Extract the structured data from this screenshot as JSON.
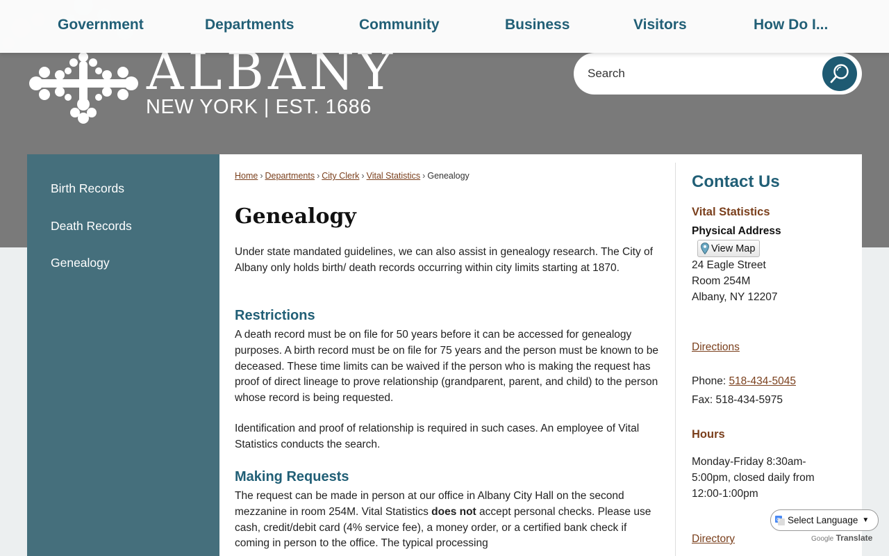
{
  "nav": {
    "items": [
      "Government",
      "Departments",
      "Community",
      "Business",
      "Visitors",
      "How Do I..."
    ]
  },
  "logo": {
    "wordmark": "ALBANY",
    "tagline": "NEW YORK | EST. 1686"
  },
  "search": {
    "placeholder": "Search"
  },
  "sidebar": {
    "items": [
      "Birth Records",
      "Death Records",
      "Genealogy"
    ]
  },
  "breadcrumb": {
    "links": [
      "Home",
      "Departments",
      "City Clerk",
      "Vital Statistics"
    ],
    "current": "Genealogy"
  },
  "main": {
    "title": "Genealogy",
    "intro": "Under state mandated guidelines, we can also assist in genealogy research. The City of Albany only holds birth/ death records occurring within city limits starting at 1870.",
    "restrictions_heading": "Restrictions",
    "restrictions_p1": "A death record must be on file for 50 years before it can be accessed for genealogy purposes. A birth record must be on file for 75 years and the person must be known to be deceased. These time limits can be waived if the person who is making the request has proof of direct lineage to prove relationship (grandparent, parent, and child) to the person whose record is being requested.",
    "restrictions_p2": "Identification and proof of relationship is required in such cases. An employee of Vital Statistics conducts the search.",
    "requests_heading": "Making Requests",
    "requests_p1_a": "The request can be made in person at our office in Albany City Hall on the second mezzanine in room 254M. Vital Statistics ",
    "requests_p1_bold": "does not",
    "requests_p1_b": " accept personal checks. Please use cash, credit/debit card (4% service fee), a money order, or a certified bank check if coming in person to the office.  The typical processing"
  },
  "contact": {
    "heading": "Contact Us",
    "dept": "Vital Statistics",
    "address_label": "Physical Address",
    "view_map": "View Map",
    "address_lines": [
      "24 Eagle Street",
      "Room 254M",
      "Albany, NY 12207"
    ],
    "directions": "Directions",
    "phone_label": "Phone: ",
    "phone": "518-434-5045",
    "fax": "Fax: 518-434-5975",
    "hours_heading": "Hours",
    "hours": "Monday-Friday 8:30am-5:00pm, closed daily from 12:00-1:00pm",
    "directory": "Directory"
  },
  "translate": {
    "label": "Select Language",
    "powered_google": "Google",
    "powered_translate": "Translate"
  },
  "colors": {
    "accent": "#215f76",
    "sidebar": "#456f7c",
    "link": "#7a3f1c",
    "hero": "#7a7a7a"
  }
}
